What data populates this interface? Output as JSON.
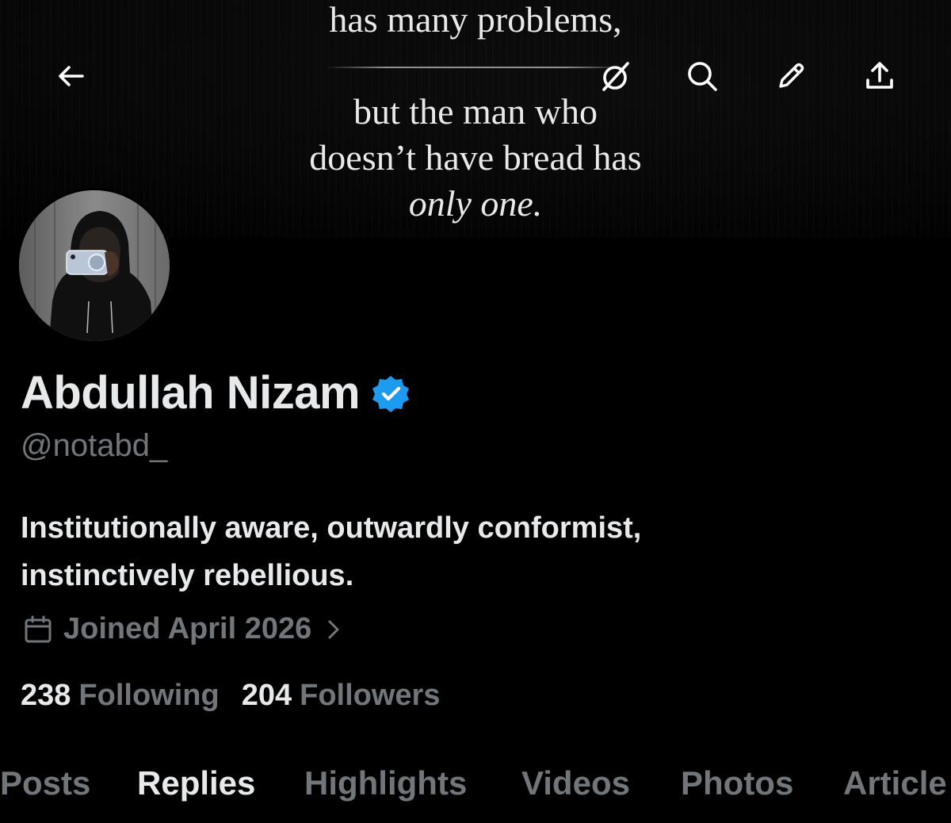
{
  "banner": {
    "quote_line1": "has many problems,",
    "quote_line2": "but the man who",
    "quote_line3": "doesn’t have bread has",
    "quote_line4": "only one."
  },
  "top_bar": {
    "icons": [
      "back-arrow-icon",
      "grok-icon",
      "search-icon",
      "edit-pencil-icon",
      "share-icon"
    ]
  },
  "profile": {
    "display_name": "Abdullah Nizam",
    "handle": "@notabd_",
    "verified": true,
    "verified_color": "#1d9bf0",
    "bio_line1": "Institutionally aware, outwardly conformist,",
    "bio_line2": "instinctively rebellious.",
    "joined": "Joined April 2026",
    "following_count": "238",
    "following_label": "Following",
    "followers_count": "204",
    "followers_label": "Followers"
  },
  "tabs": [
    {
      "label": "Posts",
      "active": false
    },
    {
      "label": "Replies",
      "active": true
    },
    {
      "label": "Highlights",
      "active": false
    },
    {
      "label": "Videos",
      "active": false
    },
    {
      "label": "Photos",
      "active": false
    },
    {
      "label": "Article",
      "active": false
    }
  ],
  "colors": {
    "background": "#000000",
    "primary_text": "#e7e9ea",
    "secondary_text": "#71767b",
    "accent": "#1d9bf0"
  }
}
